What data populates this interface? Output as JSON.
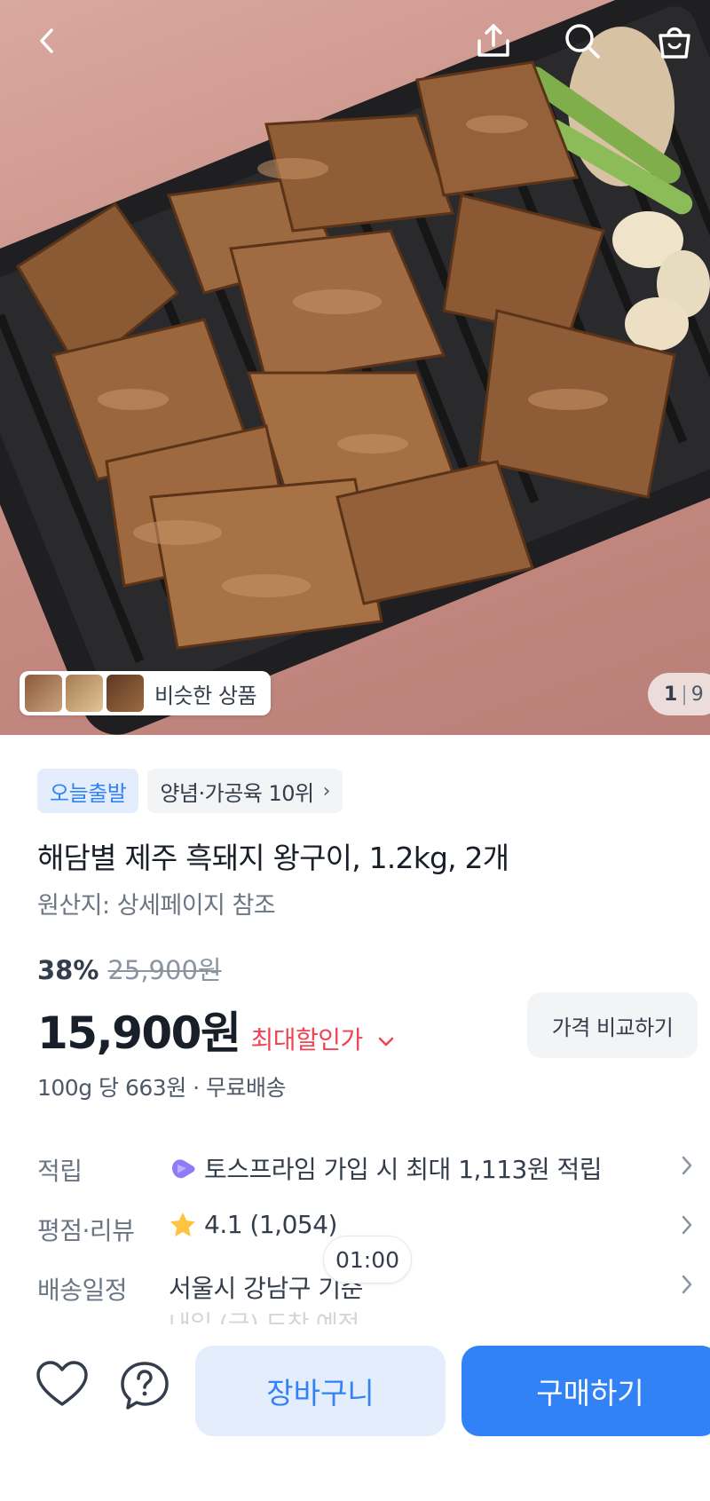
{
  "hero": {
    "similar_label": "비슷한 상품",
    "counter_current": "1",
    "counter_separator": "|",
    "counter_total": "9"
  },
  "icons": {
    "back": "chevron-left-icon",
    "share": "share-icon",
    "search": "search-icon",
    "cart": "shopping-bag-icon",
    "heart": "heart-icon",
    "question": "question-icon",
    "prime": "toss-prime-icon",
    "star": "star-icon"
  },
  "product": {
    "badge_today": "오늘출발",
    "badge_rank": "양념·가공육 10위",
    "title": "해담별 제주 흑돼지 왕구이, 1.2kg, 2개",
    "origin": "원산지: 상세페이지 참조",
    "discount_rate": "38%",
    "original_price": "25,900원",
    "price": "15,900원",
    "max_discount_label": "최대할인가",
    "compare_button": "가격 비교하기",
    "unit_price": "100g 당 663원 · 무료배송"
  },
  "info_rows": [
    {
      "key": "적립",
      "value": "토스프라임 가입 시 최대 1,113원 적립"
    },
    {
      "key": "평점·리뷰",
      "value": "4.1 (1,054)"
    },
    {
      "key": "배송일정",
      "value": "서울시 강남구 기준"
    }
  ],
  "delivery_note": "내일 (금) 도착 예정",
  "timer": "01:00",
  "actions": {
    "cart": "장바구니",
    "buy": "구매하기"
  },
  "colors": {
    "accent": "#3182f6",
    "accent_light": "#e3edfc",
    "discount_red": "#f04452",
    "star": "#ffc342"
  }
}
